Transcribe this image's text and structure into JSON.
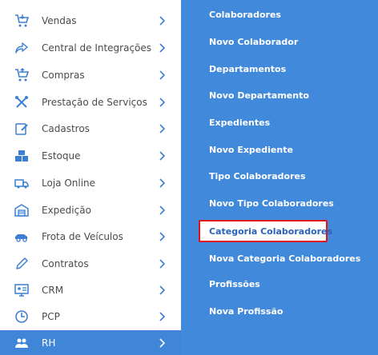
{
  "sidebar": {
    "items": [
      {
        "label": "Vendas",
        "icon": "cart-icon"
      },
      {
        "label": "Central de Integrações",
        "icon": "share-arrow-icon"
      },
      {
        "label": "Compras",
        "icon": "cart-icon"
      },
      {
        "label": "Prestação de Serviços",
        "icon": "tools-icon"
      },
      {
        "label": "Cadastros",
        "icon": "edit-icon"
      },
      {
        "label": "Estoque",
        "icon": "boxes-icon"
      },
      {
        "label": "Loja Online",
        "icon": "truck-icon"
      },
      {
        "label": "Expedição",
        "icon": "warehouse-icon"
      },
      {
        "label": "Frota de Veículos",
        "icon": "car-icon"
      },
      {
        "label": "Contratos",
        "icon": "pencil-icon"
      },
      {
        "label": "CRM",
        "icon": "monitor-icon"
      },
      {
        "label": "PCP",
        "icon": "clock-icon"
      },
      {
        "label": "RH",
        "icon": "users-icon",
        "active": true
      }
    ]
  },
  "submenu": {
    "items": [
      {
        "label": "Colaboradores"
      },
      {
        "label": "Novo Colaborador"
      },
      {
        "label": "Departamentos"
      },
      {
        "label": "Novo Departamento"
      },
      {
        "label": "Expedientes"
      },
      {
        "label": "Novo Expediente"
      },
      {
        "label": "Tipo Colaboradores"
      },
      {
        "label": "Novo Tipo Colaboradores"
      },
      {
        "label": "Categoria Colaboradores",
        "highlighted": true
      },
      {
        "label": "Nova Categoria Colaboradores"
      },
      {
        "label": "Profissões"
      },
      {
        "label": "Nova Profissão"
      }
    ]
  },
  "colors": {
    "accent": "#4189db",
    "active_item": "#3f86d9",
    "icon": "#3b7fd4",
    "highlight_border": "#e0121c"
  }
}
